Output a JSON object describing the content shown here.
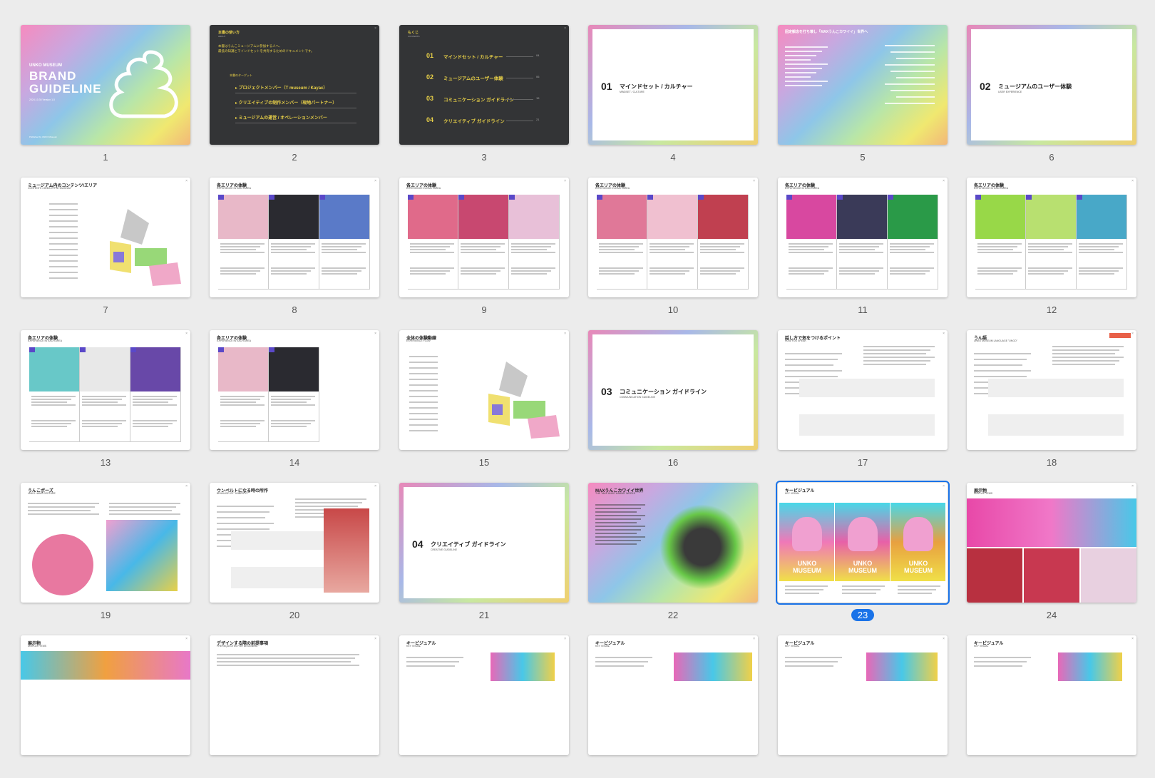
{
  "selected_slide": 23,
  "slides": [
    {
      "num": "1",
      "kind": "cover",
      "brand": "UNKO MUSEUM",
      "title1": "BRAND",
      "title2": "GUIDELINE",
      "date": "2024.10.30 Version 1.0",
      "footer": "Published by UNKO Museum"
    },
    {
      "num": "2",
      "kind": "about",
      "title": "本書の使い方",
      "sub": "ABOUT",
      "lead1": "本書はうんこミュージアムに参加する人へ、",
      "lead2": "最低の知識とマインドセットを共有するためのドキュメントです。",
      "target": "本書のターゲット",
      "items": [
        "プロジェクトメンバー（T museum / Kayac）",
        "クリエイティブの制作メンバー（現地パートナー）",
        "ミュージアムの運営 / オペレーションメンバー"
      ]
    },
    {
      "num": "3",
      "kind": "toc",
      "title": "もくじ",
      "sub": "CONTENTS",
      "items": [
        {
          "n": "01",
          "label": "マインドセット / カルチャー",
          "page": "04"
        },
        {
          "n": "02",
          "label": "ミュージアムのユーザー体験",
          "page": "06"
        },
        {
          "n": "03",
          "label": "コミュニケーション ガイドライン",
          "page": "15"
        },
        {
          "n": "04",
          "label": "クリエイティブ ガイドライン",
          "page": "21"
        }
      ]
    },
    {
      "num": "4",
      "kind": "section",
      "n": "01",
      "label": "マインドセット / カルチャー",
      "sub": "MINDSET / CULTURE"
    },
    {
      "num": "5",
      "kind": "gradtext",
      "title": "固定観念を打ち壊し「MAXうんこカワイイ」世界へ"
    },
    {
      "num": "6",
      "kind": "section",
      "n": "02",
      "label": "ミュージアムのユーザー体験",
      "sub": "USER EXPERIENCE"
    },
    {
      "num": "7",
      "kind": "map",
      "title": "ミュージアム内のコンテンツ/エリア",
      "sub": "CONTENTS / AREA IN THE MUSEUM"
    },
    {
      "num": "8",
      "kind": "area",
      "title": "各エリアの体験",
      "sub": "EXPERIENCE IN EACH AREA"
    },
    {
      "num": "9",
      "kind": "area",
      "title": "各エリアの体験",
      "sub": "EXPERIENCE IN EACH AREA"
    },
    {
      "num": "10",
      "kind": "area",
      "title": "各エリアの体験",
      "sub": "EXPERIENCE IN EACH AREA"
    },
    {
      "num": "11",
      "kind": "area",
      "title": "各エリアの体験",
      "sub": "EXPERIENCE IN EACH AREA"
    },
    {
      "num": "12",
      "kind": "area",
      "title": "各エリアの体験",
      "sub": "EXPERIENCE IN EACH AREA"
    },
    {
      "num": "13",
      "kind": "area",
      "title": "各エリアの体験",
      "sub": "EXPERIENCE IN EACH AREA"
    },
    {
      "num": "14",
      "kind": "area2",
      "title": "各エリアの体験",
      "sub": "EXPERIENCE IN EACH AREA"
    },
    {
      "num": "15",
      "kind": "map2",
      "title": "全体の体験動線",
      "sub": "EXPERIENCE FLOW"
    },
    {
      "num": "16",
      "kind": "section",
      "n": "03",
      "label": "コミュニケーション ガイドライン",
      "sub": "COMMUNICATION GUIDELINE"
    },
    {
      "num": "17",
      "kind": "text",
      "title": "話し方で気をつけるポイント",
      "sub": "HOW YOU SPEAK"
    },
    {
      "num": "18",
      "kind": "text",
      "title": "うん語",
      "sub": "UNKO MUSEUM LANGUAGE \"UNGO\""
    },
    {
      "num": "19",
      "kind": "pose",
      "title": "うんこポーズ",
      "sub": "UNKO HAND GESTURE"
    },
    {
      "num": "20",
      "kind": "text2",
      "title": "ウンベルトになる時の所作",
      "sub": "BEHAVIOR OF \"UNBERTO\""
    },
    {
      "num": "21",
      "kind": "section",
      "n": "04",
      "label": "クリエイティブ ガイドライン",
      "sub": "CREATIVE GUIDELINE"
    },
    {
      "num": "22",
      "kind": "world",
      "title": "MAXうんこカワイイ世界",
      "sub": "THE \"MAX UNKO KAWAII\" WORLD"
    },
    {
      "num": "23",
      "kind": "kv",
      "title": "キービジュアル",
      "sub": "KEY VISUAL",
      "logo": "UNKO MUSEUM"
    },
    {
      "num": "24",
      "kind": "display",
      "title": "展示物",
      "sub": "DISPLAY ITEMS"
    },
    {
      "num": "",
      "kind": "partial",
      "title": "展示物",
      "sub": "DISPLAY ITEMS"
    },
    {
      "num": "",
      "kind": "partial",
      "title": "デザインする際の前提事項",
      "sub": "PREREQUISITES FOR DESIGNING"
    },
    {
      "num": "",
      "kind": "partial",
      "title": "キービジュアル",
      "sub": "KEY VISUAL"
    },
    {
      "num": "",
      "kind": "partial",
      "title": "キービジュアル",
      "sub": "KEY VISUAL"
    },
    {
      "num": "",
      "kind": "partial",
      "title": "キービジュアル",
      "sub": "KEY VISUAL"
    },
    {
      "num": "",
      "kind": "partial",
      "title": "キービジュアル",
      "sub": "KEY VISUAL"
    }
  ]
}
